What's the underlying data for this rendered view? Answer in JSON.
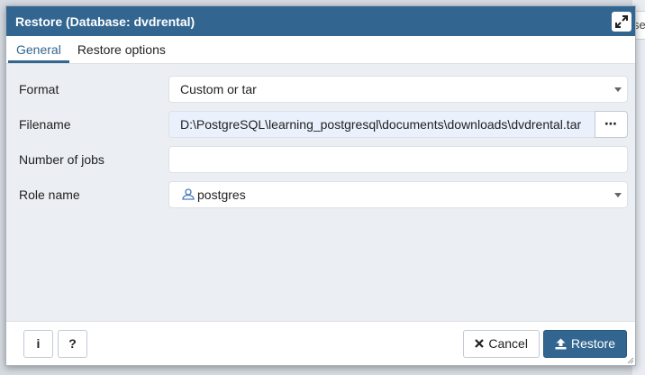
{
  "background": {
    "peek_text": "se"
  },
  "dialog": {
    "title": "Restore (Database: dvdrental)",
    "tabs": [
      {
        "label": "General",
        "active": true
      },
      {
        "label": "Restore options",
        "active": false
      }
    ],
    "fields": {
      "format": {
        "label": "Format",
        "value": "Custom or tar"
      },
      "filename": {
        "label": "Filename",
        "value": "D:\\PostgreSQL\\learning_postgresql\\documents\\downloads\\dvdrental.tar",
        "browse_label": "⋯"
      },
      "jobs": {
        "label": "Number of jobs",
        "value": ""
      },
      "role": {
        "label": "Role name",
        "value": "postgres"
      }
    },
    "footer": {
      "info_label": "i",
      "help_label": "?",
      "cancel_label": "Cancel",
      "restore_label": "Restore"
    }
  },
  "colors": {
    "titlebar": "#326690",
    "accent": "#326690",
    "file_bg": "#eaf1fc"
  }
}
